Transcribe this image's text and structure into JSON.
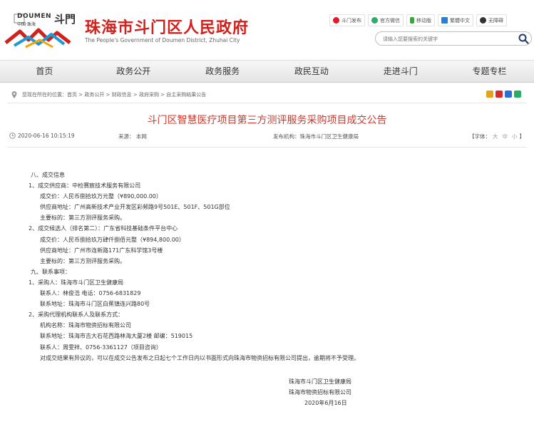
{
  "header": {
    "logo_top": "DOUMEN",
    "logo_sub": "中国·珠海",
    "logo_big": "斗門",
    "site_title": "珠海市斗门区人民政府",
    "site_en": "The People's Government of Doumen District, Zhuhai City",
    "toplinks": [
      {
        "label": "斗门发布",
        "icon": "weibo-icon",
        "color": "#e6162d"
      },
      {
        "label": "官方微信",
        "icon": "wechat-icon",
        "color": "#2aae67"
      },
      {
        "label": "移动版",
        "icon": "mobile-icon",
        "color": "#3aa53a"
      },
      {
        "label": "繁體中文",
        "icon": "traditional-chinese-icon",
        "color": "#2f7cd3"
      },
      {
        "label": "无障碍",
        "icon": "accessibility-icon",
        "color": "#333333"
      }
    ],
    "search_placeholder": "请输入您要搜索的关键字"
  },
  "nav": [
    "首页",
    "政务公开",
    "政务服务",
    "政民互动",
    "走进斗门",
    "专题专栏"
  ],
  "breadcrumb": "您现在所在的位置：首页 > 政务公开 > 财政信息 > 政府采购 > 自主采购结果公告",
  "share_icons": [
    {
      "name": "qzone-share-icon",
      "color": "#e8a21a"
    },
    {
      "name": "weibo-share-icon",
      "color": "#d52b2b"
    },
    {
      "name": "renren-share-icon",
      "color": "#2b6fd2"
    },
    {
      "name": "wechat-share-icon",
      "color": "#2aae67"
    }
  ],
  "article": {
    "title": "斗门区智慧医疗项目第三方测评服务采购项目成交公告",
    "date": "2020-06-16 10:15:19",
    "source": "来源：  本网",
    "org": "发布机构：珠海市斗门区卫生健康局",
    "font_label": "【字体：",
    "font_large": "大",
    "font_medium": "中",
    "font_small": "小",
    "font_end": "】"
  },
  "body": {
    "lines": [
      {
        "indent": "ind1",
        "text": "八、成交信息"
      },
      {
        "indent": "",
        "text": "1、成交供应商：中检赛宸技术服务有限公司"
      },
      {
        "indent": "ind2",
        "text": "成交价：人民币捌拾玖万元整（¥890,000.00）"
      },
      {
        "indent": "ind2",
        "text": "供应商地址：广州高新技术产业开发区彩频路9号501E、501F、501G部位"
      },
      {
        "indent": "ind2",
        "text": "主要标的：第三方测评服务采购。"
      },
      {
        "indent": "",
        "text": "2、成交候选人（排名第二）：广东省科技基础条件平台中心"
      },
      {
        "indent": "ind2",
        "text": "成交价：人民币捌拾玖万肆仟捌佰元整（¥894,800.00）"
      },
      {
        "indent": "ind2",
        "text": "供应商地址：广州市连新路171广东科学馆3号楼"
      },
      {
        "indent": "ind2",
        "text": "主要标的：第三方测评服务采购。"
      },
      {
        "indent": "ind1",
        "text": "九、联系事项："
      },
      {
        "indent": "",
        "text": "1、采购人：珠海市斗门区卫生健康局"
      },
      {
        "indent": "ind2",
        "text": "联系人：林俊浩  电话：0756-6831829"
      },
      {
        "indent": "ind2",
        "text": "联系地址：珠海市斗门区白蕉镇连兴路80号"
      },
      {
        "indent": "",
        "text": "2、采购代理机构联系人及联系方式："
      },
      {
        "indent": "ind2",
        "text": "机构名称：珠海市物资招标有限公司"
      },
      {
        "indent": "ind2",
        "text": "联系地址：珠海市吉大石花西路林海大厦2楼  邮编：519015"
      },
      {
        "indent": "ind2",
        "text": "联系人：周雯祥、0756-3361127（项目咨询）"
      },
      {
        "indent": "ind2",
        "text": "对成交结果有异议的，可以在成交公告发布之日起七个工作日内以书面形式向珠海市物资招标有限公司提出，逾期将不予受理。"
      }
    ],
    "signoff": [
      "珠海市斗门区卫生健康局",
      "珠海市物资招标有限公司",
      "2020年6月16日"
    ]
  }
}
